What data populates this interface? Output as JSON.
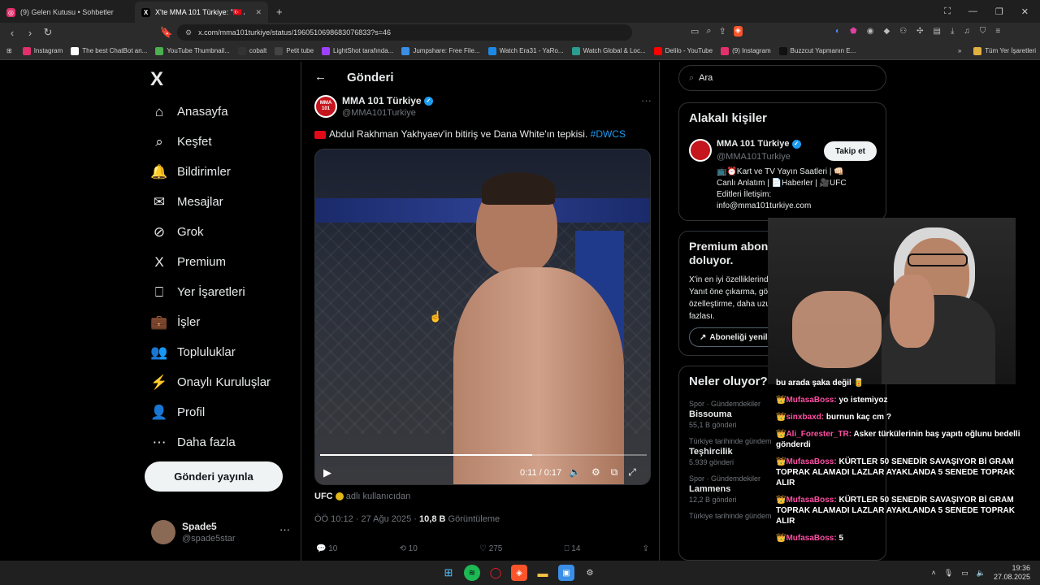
{
  "browser": {
    "tabs": [
      {
        "title": "(9) Gelen Kutusu • Sohbetler"
      },
      {
        "title": "X'te MMA 101 Türkiye: \"🇹🇷 Abdul..."
      }
    ],
    "new_tab": "+",
    "url": "x.com/mma101turkiye/status/1960510698683076833?s=46",
    "bookmarks": [
      {
        "label": "Instagram",
        "color": "#e1306c"
      },
      {
        "label": "The best ChatBot an...",
        "color": "#ffffff"
      },
      {
        "label": "YouTube Thumbnail...",
        "color": "#4caf50"
      },
      {
        "label": "cobalt",
        "color": "#333333"
      },
      {
        "label": "Petit tube",
        "color": "#444444"
      },
      {
        "label": "LightShot tarafında...",
        "color": "#a040ff"
      },
      {
        "label": "Jumpshare: Free File...",
        "color": "#3a8ee6"
      },
      {
        "label": "Watch Era31 - YaRo...",
        "color": "#1e88e5"
      },
      {
        "label": "Watch Global & Loc...",
        "color": "#2a9d8f"
      },
      {
        "label": "Delilo - YouTube",
        "color": "#ff0000"
      },
      {
        "label": "(9) Instagram",
        "color": "#e1306c"
      },
      {
        "label": "Buzzcut Yapmanın E...",
        "color": "#111111"
      }
    ],
    "bookmarks_more": "»",
    "all_bookmarks": "Tüm Yer İşaretleri"
  },
  "nav": {
    "logo": "X",
    "items": [
      {
        "label": "Anasayfa",
        "icon": "home-icon"
      },
      {
        "label": "Keşfet",
        "icon": "search-icon"
      },
      {
        "label": "Bildirimler",
        "icon": "bell-icon"
      },
      {
        "label": "Mesajlar",
        "icon": "mail-icon"
      },
      {
        "label": "Grok",
        "icon": "grok-icon"
      },
      {
        "label": "Premium",
        "icon": "x-premium-icon"
      },
      {
        "label": "Yer İşaretleri",
        "icon": "bookmark-icon"
      },
      {
        "label": "İşler",
        "icon": "briefcase-icon"
      },
      {
        "label": "Topluluklar",
        "icon": "people-icon"
      },
      {
        "label": "Onaylı Kuruluşlar",
        "icon": "lightning-icon"
      },
      {
        "label": "Profil",
        "icon": "person-icon"
      },
      {
        "label": "Daha fazla",
        "icon": "more-circle-icon"
      }
    ],
    "post_button": "Gönderi yayınla",
    "profile": {
      "name": "Spade5",
      "handle": "@spade5star",
      "more": "···"
    }
  },
  "post": {
    "header_title": "Gönderi",
    "author_name": "MMA 101 Türkiye",
    "author_handle": "@MMA101Turkiye",
    "avatar_text": "MMA 101",
    "more": "···",
    "text": "Abdul Rakhman Yakhyaev'in bitiriş ve Dana White'ın tepkisi.",
    "hashtag": "#DWCS",
    "video": {
      "time": "0:11 / 0:17",
      "progress": 0.65
    },
    "source_name": "UFC",
    "source_suffix": "adlı kullanıcıdan",
    "timestamp": "ÖÖ 10:12 · 27 Ağu 2025 ·",
    "views_count": "10,8 B",
    "views_label": "Görüntüleme",
    "actions": {
      "replies": "10",
      "reposts": "10",
      "likes": "275",
      "bookmarks": "14"
    }
  },
  "sidebar": {
    "search_placeholder": "Ara",
    "related": {
      "title": "Alakalı kişiler",
      "name": "MMA 101 Türkiye",
      "handle": "@MMA101Turkiye",
      "follow": "Takip et",
      "bio": "📺⏰Kart ve TV Yayın Saatleri | 👊🏻 Canlı Anlatım | 📄Haberler | 🎥UFC Editleri İletişim: info@mma101turkiye.com"
    },
    "premium": {
      "title": "Premium aboneliğinin süresi doluyor.",
      "body": "X'in en iyi özelliklerinden yararlanmaya devam et. Yanıt öne çıkarma, gönderi düzenleme, özelleştirme, daha uzun gönderiler ve çok daha fazlası.",
      "button": "Aboneliği yenile"
    },
    "trends": {
      "title": "Neler oluyor?",
      "items": [
        {
          "meta": "Spor · Gündemdekiler",
          "name": "Bissouma",
          "count": "55,1 B gönderi"
        },
        {
          "meta": "Türkiye tarihinde gündem",
          "name": "Teşhircilik",
          "count": "5.939 gönderi"
        },
        {
          "meta": "Spor · Gündemdekiler",
          "name": "Lammens",
          "count": "12,2 B gönderi"
        },
        {
          "meta": "Türkiye tarihinde gündem",
          "name": "",
          "count": ""
        }
      ]
    }
  },
  "chat": {
    "messages": [
      {
        "user": "",
        "text": "bu arada şaka değil 🥫"
      },
      {
        "user": "MufasaBoss:",
        "text": "yo istemiyoz"
      },
      {
        "user": "sinxbaxd:",
        "text": "burnun kaç cm ?"
      },
      {
        "user": "Ali_Forester_TR:",
        "text": "Asker türkülerinin baş yapıtı oğlunu bedelli gönderdi"
      },
      {
        "user": "MufasaBoss:",
        "text": "KÜRTLER 50 SENEDİR SAVAŞIYOR Bİ GRAM TOPRAK ALAMADI LAZLAR AYAKLANDA 5 SENEDE TOPRAK ALIR"
      },
      {
        "user": "MufasaBoss:",
        "text": "KÜRTLER 50 SENEDİR SAVAŞIYOR Bİ GRAM TOPRAK ALAMADI LAZLAR AYAKLANDA 5 SENEDE TOPRAK ALIR"
      },
      {
        "user": "MufasaBoss:",
        "text": "5"
      }
    ]
  },
  "taskbar": {
    "time": "19:36",
    "date": "27.08.2025"
  }
}
